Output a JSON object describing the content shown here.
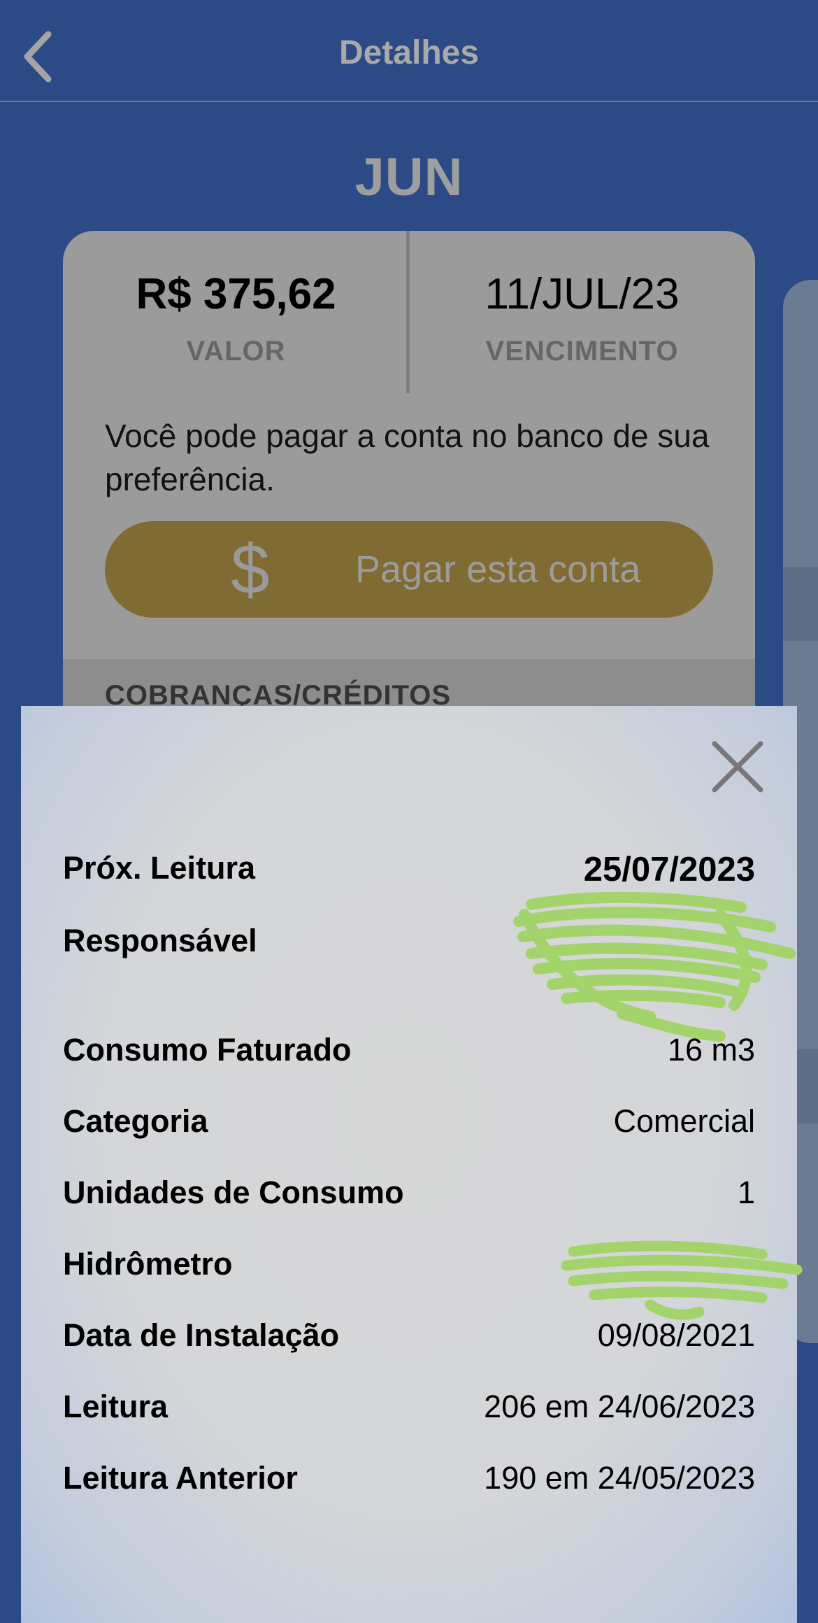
{
  "header": {
    "title": "Detalhes",
    "back_icon": "chevron-left-icon"
  },
  "month": "JUN",
  "bill": {
    "amount": "R$ 375,62",
    "amount_label": "VALOR",
    "due_date": "11/JUL/23",
    "due_label": "VENCIMENTO",
    "info": "Você pode pagar a conta no banco de sua preferência.",
    "pay_button_label": "Pagar esta conta",
    "pay_icon": "$",
    "charges_title": "COBRANÇAS/CRÉDITOS"
  },
  "modal": {
    "close_icon": "close-icon",
    "rows": [
      {
        "label": "Próx. Leitura",
        "value": "25/07/2023"
      },
      {
        "label": "Responsável",
        "value": ""
      },
      {
        "label": "Consumo Faturado",
        "value": "16 m3"
      },
      {
        "label": "Categoria",
        "value": "Comercial"
      },
      {
        "label": "Unidades de Consumo",
        "value": "1"
      },
      {
        "label": "Hidrômetro",
        "value": ""
      },
      {
        "label": "Data de Instalação",
        "value": "09/08/2021"
      },
      {
        "label": "Leitura",
        "value": "206 em 24/06/2023"
      },
      {
        "label": "Leitura Anterior",
        "value": "190 em 24/05/2023"
      }
    ]
  },
  "colors": {
    "background": "#2c4a86",
    "card": "#9b9b9b",
    "pay_button": "#806c32",
    "redaction": "#a3d46b"
  }
}
